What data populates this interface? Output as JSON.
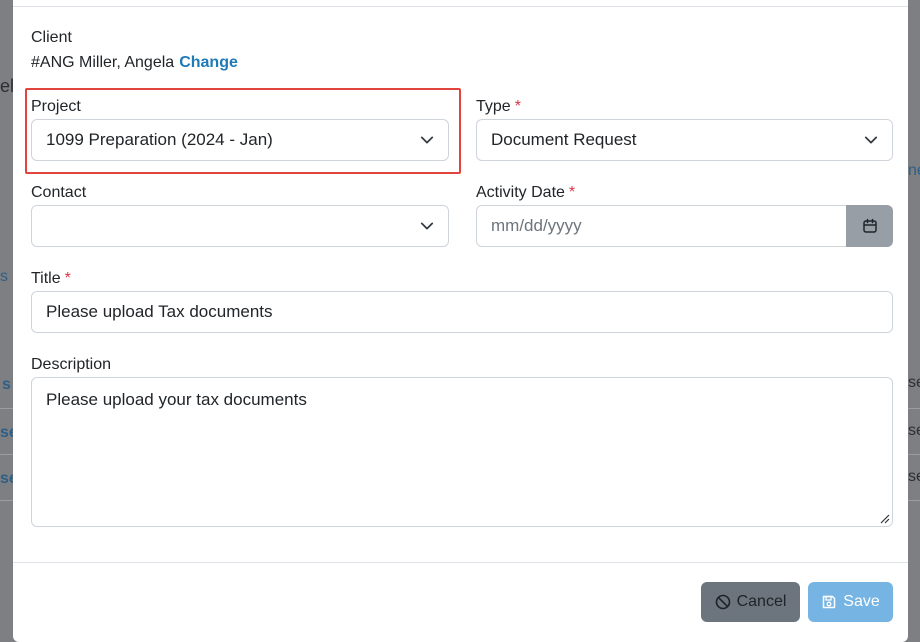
{
  "backdrop": {
    "left_fragments": [
      "el",
      "s",
      "s",
      "se",
      "se"
    ],
    "right_fragments": [
      "ne",
      "se",
      "se",
      "se"
    ]
  },
  "client": {
    "label": "Client",
    "value": "#ANG Miller, Angela",
    "change_link": "Change"
  },
  "project": {
    "label": "Project",
    "value": "1099 Preparation (2024 - Jan)"
  },
  "type": {
    "label": "Type",
    "required_mark": "*",
    "value": "Document Request"
  },
  "contact": {
    "label": "Contact",
    "value": ""
  },
  "activity_date": {
    "label": "Activity Date",
    "required_mark": "*",
    "placeholder": "mm/dd/yyyy",
    "icon": "calendar-icon"
  },
  "title": {
    "label": "Title",
    "required_mark": "*",
    "value": "Please upload Tax documents"
  },
  "description": {
    "label": "Description",
    "value": "Please upload your tax documents"
  },
  "footer": {
    "cancel_label": "Cancel",
    "save_label": "Save",
    "cancel_icon": "ban-icon",
    "save_icon": "floppy-disk-icon"
  },
  "colors": {
    "link": "#1f7ab8",
    "required": "#dc3545",
    "highlight": "#e0443c",
    "cancel_bg": "#6c757d",
    "save_bg": "#75b4e3"
  }
}
